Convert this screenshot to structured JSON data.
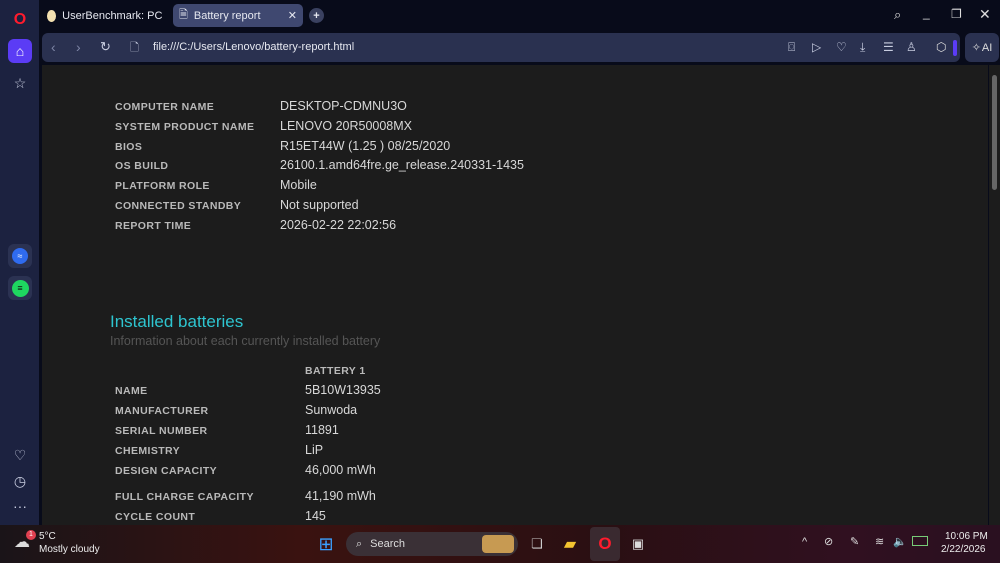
{
  "browser": {
    "tabs": [
      {
        "label": "UserBenchmark: PC Speed",
        "active": false
      },
      {
        "label": "Battery report",
        "active": true
      }
    ],
    "url": "file:///C:/Users/Lenovo/battery-report.html",
    "ai_label": "AI"
  },
  "report": {
    "system": [
      {
        "label": "COMPUTER NAME",
        "value": "DESKTOP-CDMNU3O"
      },
      {
        "label": "SYSTEM PRODUCT NAME",
        "value": "LENOVO 20R50008MX"
      },
      {
        "label": "BIOS",
        "value": "R15ET44W (1.25 ) 08/25/2020"
      },
      {
        "label": "OS BUILD",
        "value": "26100.1.amd64fre.ge_release.240331-1435"
      },
      {
        "label": "PLATFORM ROLE",
        "value": "Mobile"
      },
      {
        "label": "CONNECTED STANDBY",
        "value": "Not supported"
      },
      {
        "label": "REPORT TIME",
        "value": "2026-02-22  22:02:56"
      }
    ],
    "batteries_title": "Installed batteries",
    "batteries_subtitle": "Information about each currently installed battery",
    "battery_header": "BATTERY 1",
    "battery": [
      {
        "label": "NAME",
        "value": "5B10W13935"
      },
      {
        "label": "MANUFACTURER",
        "value": "Sunwoda"
      },
      {
        "label": "SERIAL NUMBER",
        "value": "11891"
      },
      {
        "label": "CHEMISTRY",
        "value": "LiP"
      },
      {
        "label": "DESIGN CAPACITY",
        "value": "46,000 mWh"
      },
      {
        "label": "FULL CHARGE CAPACITY",
        "value": "41,190 mWh"
      },
      {
        "label": "CYCLE COUNT",
        "value": "145"
      }
    ]
  },
  "taskbar": {
    "weather_temp": "5°C",
    "weather_desc": "Mostly cloudy",
    "weather_badge": "1",
    "search": "Search",
    "time": "10:06 PM",
    "date": "2/22/2026"
  },
  "colors": {
    "accent": "#2ec5d0",
    "sidebar": "#1c2240",
    "home": "#5b3cf5"
  }
}
